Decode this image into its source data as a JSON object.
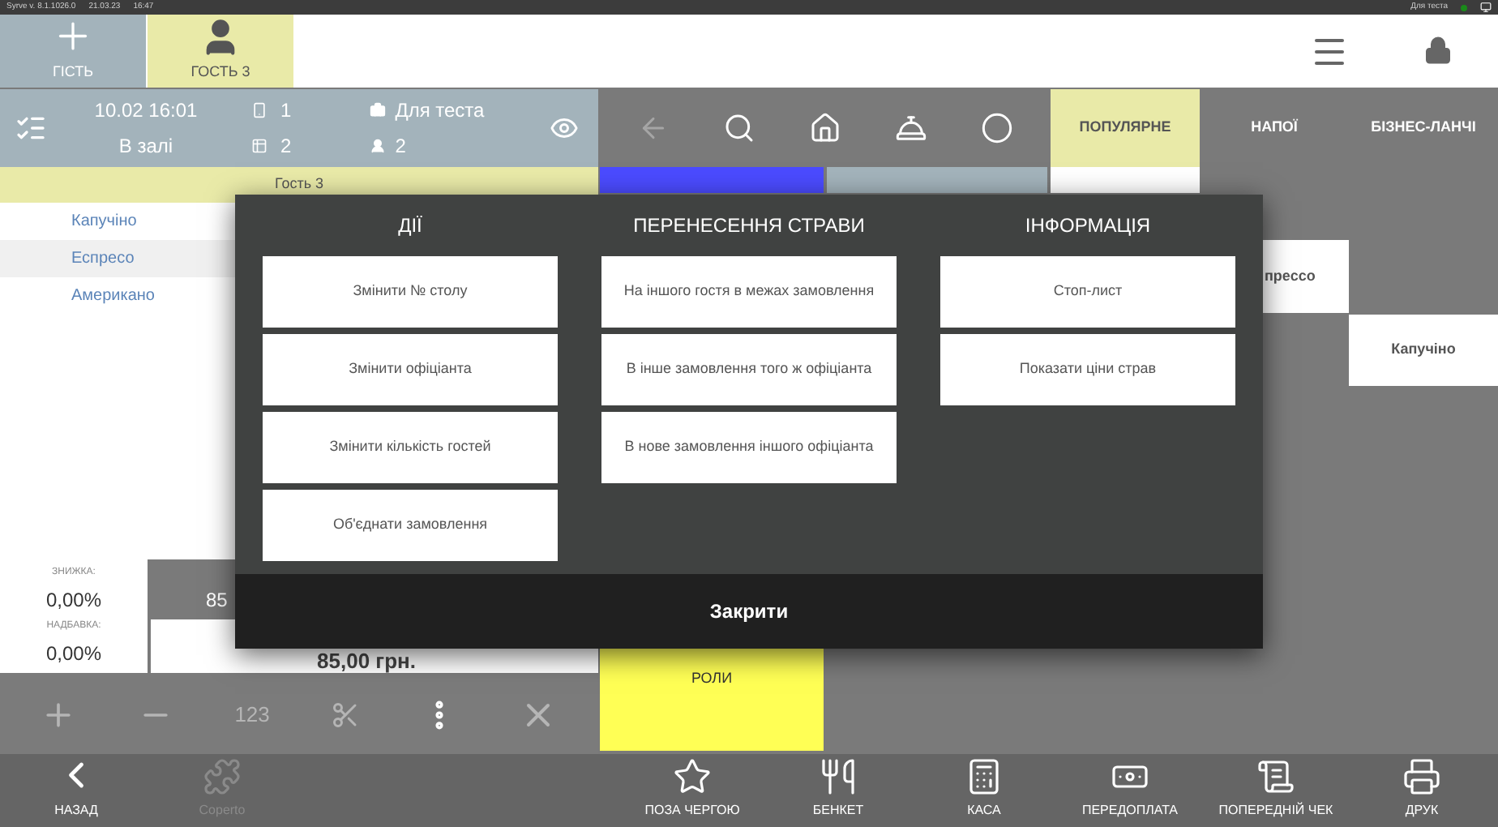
{
  "status_bar": {
    "version": "Syrve v. 8.1.1026.0",
    "date": "21.03.23",
    "time": "16:47",
    "terminal": "Для теста",
    "online": true
  },
  "guest_tabs": [
    {
      "kind": "add",
      "label": "ГІСТЬ",
      "selected": false
    },
    {
      "kind": "guest",
      "label": "ГОСТЬ 3",
      "selected": true
    }
  ],
  "order_info": {
    "datetime": "10.02 16:01",
    "section": "В залі",
    "order_number": "1",
    "table": "2",
    "waiter": "Для теста",
    "guests": "2"
  },
  "guest_header": "Гость 3",
  "order_items": [
    {
      "name": "Капучіно",
      "selected": false
    },
    {
      "name": "Еспресо",
      "selected": true
    },
    {
      "name": "Американо",
      "selected": false
    }
  ],
  "discount": {
    "label": "ЗНИЖКА:",
    "value": "0,00%"
  },
  "markup": {
    "label": "НАДБАВКА:",
    "value": "0,00%"
  },
  "subtotal": "85",
  "total": "85,00 грн.",
  "order_tools": [
    {
      "kind": "plus"
    },
    {
      "kind": "minus"
    },
    {
      "kind": "text",
      "label": "123"
    },
    {
      "kind": "split"
    },
    {
      "kind": "more"
    },
    {
      "kind": "delete"
    }
  ],
  "menu_tools": [
    {
      "kind": "back",
      "disabled": true
    },
    {
      "kind": "search",
      "disabled": false
    },
    {
      "kind": "home",
      "disabled": false
    },
    {
      "kind": "dish",
      "disabled": false
    },
    {
      "kind": "circle",
      "disabled": false
    }
  ],
  "categories": [
    {
      "label": "ПОПУЛЯРНЕ",
      "selected": true
    },
    {
      "label": "НАПОЇ",
      "selected": false
    },
    {
      "label": "БІЗНЕС-ЛАНЧІ",
      "selected": false
    }
  ],
  "group_tiles": [
    {
      "color": "#4b4bff"
    },
    {
      "color": "#a3b3bb"
    },
    {
      "color": "#ffff55",
      "label": "РОЛИ"
    }
  ],
  "products": [
    {
      "kind": "blank"
    },
    {
      "kind": "dish",
      "label": "прессо"
    },
    {
      "kind": "dish",
      "label": "Капучіно"
    }
  ],
  "dialog": {
    "columns": [
      {
        "title": "ДІЇ",
        "buttons": [
          "Змінити № столу",
          "Змінити офіціанта",
          "Змінити кількість гостей",
          "Об'єднати замовлення"
        ]
      },
      {
        "title": "ПЕРЕНЕСЕННЯ СТРАВИ",
        "buttons": [
          "На іншого гостя в межах замовлення",
          "В інше замовлення того ж офіціанта",
          "В нове замовлення іншого офіціанта"
        ]
      },
      {
        "title": "ІНФОРМАЦІЯ",
        "buttons": [
          "Стоп-лист",
          "Показати ціни страв"
        ]
      }
    ],
    "close": "Закрити"
  },
  "bottom_nav": [
    {
      "kind": "back",
      "label": "НАЗАД",
      "disabled": false
    },
    {
      "kind": "coperto",
      "label": "Coperto",
      "disabled": true
    },
    {
      "kind": "spacer"
    },
    {
      "kind": "star",
      "label": "ПОЗА ЧЕРГОЮ",
      "disabled": false
    },
    {
      "kind": "banquet",
      "label": "БЕНКЕТ",
      "disabled": false
    },
    {
      "kind": "cash",
      "label": "КАСА",
      "disabled": false
    },
    {
      "kind": "prepay",
      "label": "ПЕРЕДОПЛАТА",
      "disabled": false
    },
    {
      "kind": "receipt",
      "label": "ПОПЕРЕДНІЙ ЧЕК",
      "disabled": false
    },
    {
      "kind": "print",
      "label": "ДРУК",
      "disabled": false
    }
  ]
}
